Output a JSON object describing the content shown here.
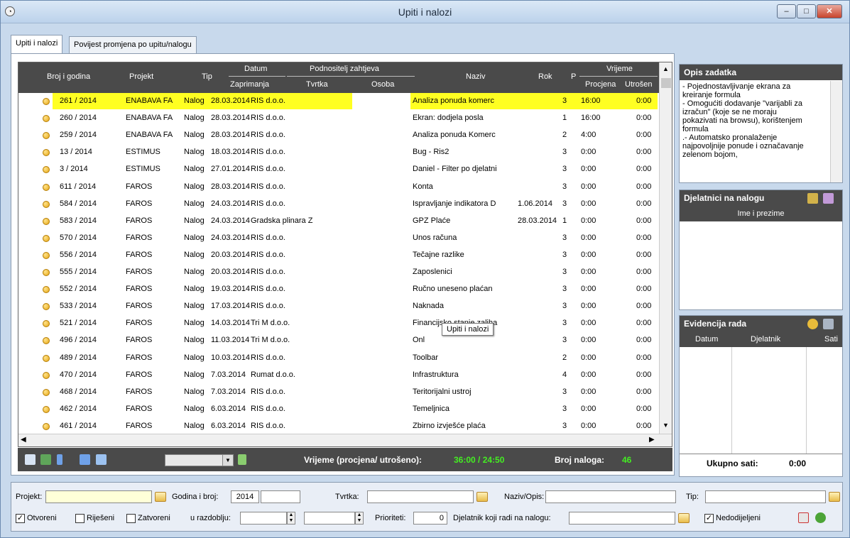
{
  "window": {
    "title": "Upiti i nalozi",
    "min": "–",
    "max": "□",
    "close": "✕"
  },
  "tabs": [
    {
      "label": "Upiti i nalozi"
    },
    {
      "label": "Povijest promjena po upitu/nalogu"
    }
  ],
  "grid": {
    "headers": {
      "broj": "Broj i godina",
      "projekt": "Projekt",
      "tip": "Tip",
      "datum": "Datum",
      "zaprimanja": "Zaprimanja",
      "podnositelj": "Podnositelj zahtjeva",
      "tvrtka": "Tvrtka",
      "osoba": "Osoba",
      "naziv": "Naziv",
      "rok": "Rok",
      "p": "P",
      "vrijeme": "Vrijeme",
      "procjena": "Procjena",
      "utroseno": "Utrošen"
    },
    "rows": [
      {
        "broj": "261 / 2014",
        "projekt": "ENABAVA FA",
        "tip": "Nalog",
        "datum": "28.03.2014",
        "tvrtka": "RIS d.o.o.",
        "naziv": "Analiza ponuda komerc",
        "rok": "",
        "p": "3",
        "procjena": "16:00",
        "utroseno": "0:00"
      },
      {
        "broj": "260 / 2014",
        "projekt": "ENABAVA FA",
        "tip": "Nalog",
        "datum": "28.03.2014",
        "tvrtka": "RIS d.o.o.",
        "naziv": "Ekran: dodjela posla",
        "rok": "",
        "p": "1",
        "procjena": "16:00",
        "utroseno": "0:00"
      },
      {
        "broj": "259 / 2014",
        "projekt": "ENABAVA FA",
        "tip": "Nalog",
        "datum": "28.03.2014",
        "tvrtka": "RIS d.o.o.",
        "naziv": "Analiza ponuda Komerc",
        "rok": "",
        "p": "2",
        "procjena": "4:00",
        "utroseno": "0:00"
      },
      {
        "broj": "13 / 2014",
        "projekt": "ESTIMUS",
        "tip": "Nalog",
        "datum": "18.03.2014",
        "tvrtka": "RIS d.o.o.",
        "naziv": "Bug - Ris2",
        "rok": "",
        "p": "3",
        "procjena": "0:00",
        "utroseno": "0:00"
      },
      {
        "broj": "3 / 2014",
        "projekt": "ESTIMUS",
        "tip": "Nalog",
        "datum": "27.01.2014",
        "tvrtka": "RIS d.o.o.",
        "naziv": "Daniel - Filter po djelatni",
        "rok": "",
        "p": "3",
        "procjena": "0:00",
        "utroseno": "0:00"
      },
      {
        "broj": "611 / 2014",
        "projekt": "FAROS",
        "tip": "Nalog",
        "datum": "28.03.2014",
        "tvrtka": "RIS d.o.o.",
        "naziv": "Konta",
        "rok": "",
        "p": "3",
        "procjena": "0:00",
        "utroseno": "0:00"
      },
      {
        "broj": "584 / 2014",
        "projekt": "FAROS",
        "tip": "Nalog",
        "datum": "24.03.2014",
        "tvrtka": "RIS d.o.o.",
        "naziv": "Ispravljanje indikatora D",
        "rok": "1.06.2014",
        "p": "3",
        "procjena": "0:00",
        "utroseno": "0:00"
      },
      {
        "broj": "583 / 2014",
        "projekt": "FAROS",
        "tip": "Nalog",
        "datum": "24.03.2014",
        "tvrtka": "Gradska plinara Z",
        "naziv": "GPZ Plaće",
        "rok": "28.03.2014",
        "p": "1",
        "procjena": "0:00",
        "utroseno": "0:00"
      },
      {
        "broj": "570 / 2014",
        "projekt": "FAROS",
        "tip": "Nalog",
        "datum": "24.03.2014",
        "tvrtka": "RIS d.o.o.",
        "naziv": "Unos računa",
        "rok": "",
        "p": "3",
        "procjena": "0:00",
        "utroseno": "0:00"
      },
      {
        "broj": "556 / 2014",
        "projekt": "FAROS",
        "tip": "Nalog",
        "datum": "20.03.2014",
        "tvrtka": "RIS d.o.o.",
        "naziv": "Tečajne razlike",
        "rok": "",
        "p": "3",
        "procjena": "0:00",
        "utroseno": "0:00"
      },
      {
        "broj": "555 / 2014",
        "projekt": "FAROS",
        "tip": "Nalog",
        "datum": "20.03.2014",
        "tvrtka": "RIS d.o.o.",
        "naziv": "Zaposlenici",
        "rok": "",
        "p": "3",
        "procjena": "0:00",
        "utroseno": "0:00"
      },
      {
        "broj": "552 / 2014",
        "projekt": "FAROS",
        "tip": "Nalog",
        "datum": "19.03.2014",
        "tvrtka": "RIS d.o.o.",
        "naziv": "Ručno uneseno plaćan",
        "rok": "",
        "p": "3",
        "procjena": "0:00",
        "utroseno": "0:00"
      },
      {
        "broj": "533 / 2014",
        "projekt": "FAROS",
        "tip": "Nalog",
        "datum": "17.03.2014",
        "tvrtka": "RIS d.o.o.",
        "naziv": "Naknada",
        "rok": "",
        "p": "3",
        "procjena": "0:00",
        "utroseno": "0:00"
      },
      {
        "broj": "521 / 2014",
        "projekt": "FAROS",
        "tip": "Nalog",
        "datum": "14.03.2014",
        "tvrtka": "Tri M d.o.o.",
        "naziv": "Financijsko stanje zaliha",
        "rok": "",
        "p": "3",
        "procjena": "0:00",
        "utroseno": "0:00"
      },
      {
        "broj": "496 / 2014",
        "projekt": "FAROS",
        "tip": "Nalog",
        "datum": "11.03.2014",
        "tvrtka": "Tri M d.o.o.",
        "naziv": "Onl",
        "rok": "",
        "p": "3",
        "procjena": "0:00",
        "utroseno": "0:00"
      },
      {
        "broj": "489 / 2014",
        "projekt": "FAROS",
        "tip": "Nalog",
        "datum": "10.03.2014",
        "tvrtka": "RIS d.o.o.",
        "naziv": "Toolbar",
        "rok": "",
        "p": "2",
        "procjena": "0:00",
        "utroseno": "0:00"
      },
      {
        "broj": "470 / 2014",
        "projekt": "FAROS",
        "tip": "Nalog",
        "datum": "7.03.2014",
        "tvrtka": "Rumat d.o.o.",
        "naziv": "Infrastruktura",
        "rok": "",
        "p": "4",
        "procjena": "0:00",
        "utroseno": "0:00"
      },
      {
        "broj": "468 / 2014",
        "projekt": "FAROS",
        "tip": "Nalog",
        "datum": "7.03.2014",
        "tvrtka": "RIS d.o.o.",
        "naziv": "Teritorijalni ustroj",
        "rok": "",
        "p": "3",
        "procjena": "0:00",
        "utroseno": "0:00"
      },
      {
        "broj": "462 / 2014",
        "projekt": "FAROS",
        "tip": "Nalog",
        "datum": "6.03.2014",
        "tvrtka": "RIS d.o.o.",
        "naziv": "Temeljnica",
        "rok": "",
        "p": "3",
        "procjena": "0:00",
        "utroseno": "0:00"
      },
      {
        "broj": "461 / 2014",
        "projekt": "FAROS",
        "tip": "Nalog",
        "datum": "6.03.2014",
        "tvrtka": "RIS d.o.o.",
        "naziv": "Zbirno izvješće plaća",
        "rok": "",
        "p": "3",
        "procjena": "0:00",
        "utroseno": "0:00"
      }
    ],
    "tooltip": "Upiti i nalozi"
  },
  "toolbar": {
    "vrijeme_label": "Vrijeme (procjena/ utrošeno):",
    "vrijeme_value": "36:00 / 24:50",
    "broj_label": "Broj naloga:",
    "broj_value": "46"
  },
  "opis": {
    "title": "Opis zadatka",
    "lines": [
      "- Pojednostavljivanje ekrana za",
      "kreiranje formula",
      "- Omogućiti dodavanje \"varijabli za",
      "izračun\" (koje se ne moraju",
      "pokazivati na browsu), korištenjem",
      "formula",
      ".- Automatsko pronalaženje",
      "najpovoljnije ponude i označavanje",
      "zelenom bojom,"
    ]
  },
  "djelatnici": {
    "title": "Djelatnici na nalogu",
    "column": "Ime i prezime"
  },
  "evidencija": {
    "title": "Evidencija rada",
    "columns": [
      "Datum",
      "Djelatnik",
      "Sati"
    ],
    "total_label": "Ukupno sati:",
    "total_value": "0:00"
  },
  "filters": {
    "projekt_label": "Projekt:",
    "godina_label": "Godina i broj:",
    "godina_value": "2014",
    "tvrtka_label": "Tvrtka:",
    "naziv_label": "Naziv/Opis:",
    "tip_label": "Tip:",
    "otvoreni": "Otvoreni",
    "rijeseni": "Riješeni",
    "zatvoreni": "Zatvoreni",
    "razdoblje": "u razdoblju:",
    "prioriteti_label": "Prioriteti:",
    "prioriteti_value": "0",
    "djelatnik_label": "Djelatnik koji radi na nalogu:",
    "nedodijeljeni": "Nedodijeljeni"
  }
}
